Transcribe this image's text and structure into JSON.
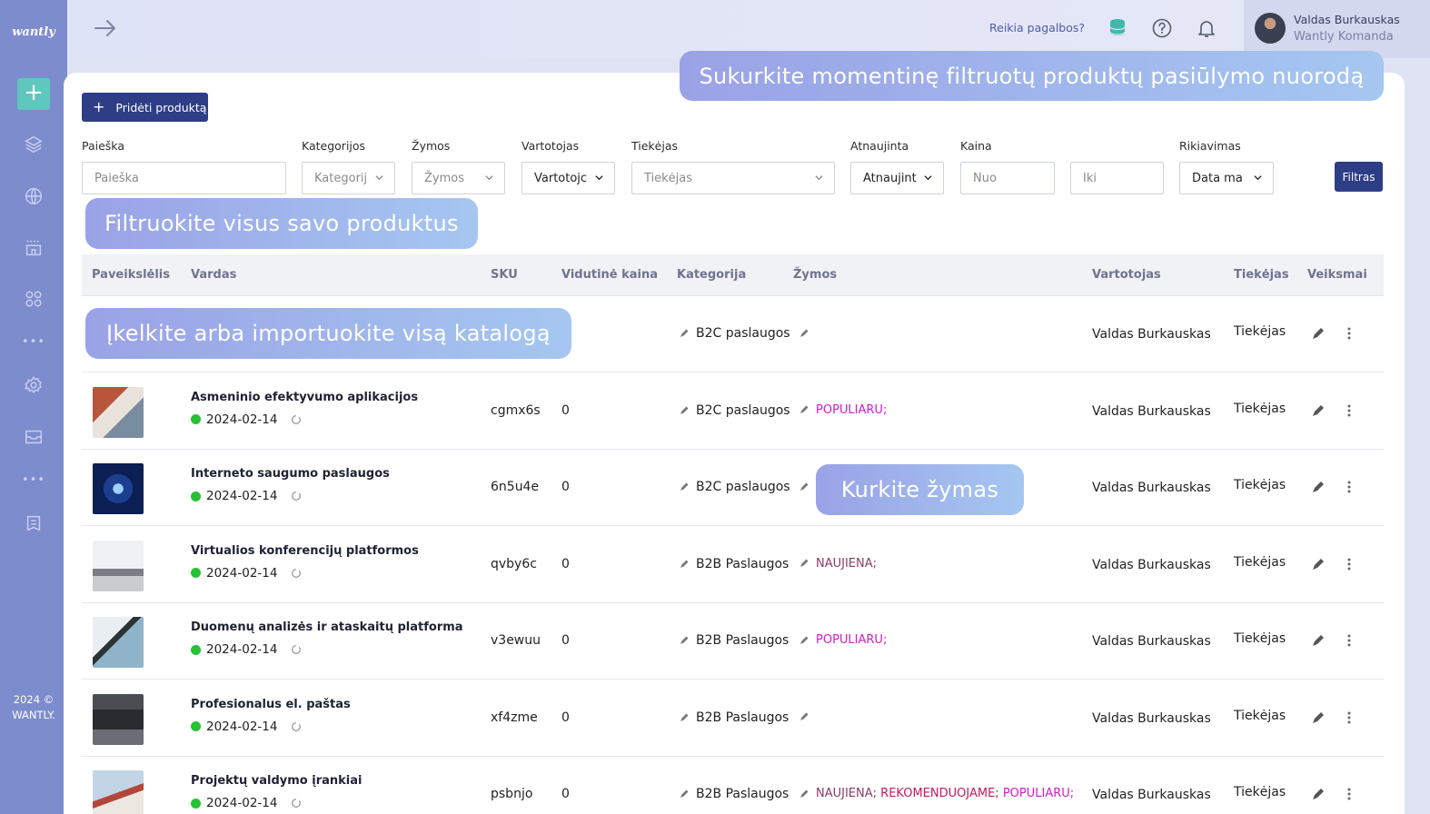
{
  "sidebar": {
    "logo": "wantly",
    "add_label": "+",
    "dots": "•••",
    "footer_year": "2024 ©",
    "footer_brand": "WANTLY."
  },
  "header": {
    "help_text": "Reikia pagalbos?",
    "user_name": "Valdas Burkauskas",
    "user_team": "Wantly Komanda"
  },
  "toolbar": {
    "add_product_label": "Pridėti produktą",
    "filter_button_label": "Filtras"
  },
  "filters": {
    "search": {
      "label": "Paieška",
      "placeholder": "Paieška"
    },
    "categories": {
      "label": "Kategorijos",
      "value": "Kategorij"
    },
    "tags": {
      "label": "Žymos",
      "value": "Žymos"
    },
    "user": {
      "label": "Vartotojas",
      "value": "Vartotojc"
    },
    "supplier": {
      "label": "Tiekėjas",
      "value": "Tiekėjas"
    },
    "updated": {
      "label": "Atnaujinta",
      "value": "Atnaujint"
    },
    "price": {
      "label": "Kaina",
      "from_placeholder": "Nuo",
      "to_placeholder": "Iki"
    },
    "sort": {
      "label": "Rikiavimas",
      "value": "Data ma"
    }
  },
  "table": {
    "columns": [
      "Paveikslėlis",
      "Vardas",
      "SKU",
      "Vidutinė kaina",
      "Kategorija",
      "Žymos",
      "Vartotojas",
      "Tiekėjas",
      "Veiksmai"
    ],
    "rows": [
      {
        "name": "",
        "date": "",
        "sku": "",
        "price": "",
        "category": "B2C paslaugos",
        "tags": [],
        "user": "Valdas Burkauskas",
        "supplier": "Tiekėjas"
      },
      {
        "name": "Asmeninio efektyvumo aplikacijos",
        "date": "2024-02-14",
        "sku": "cgmx6s",
        "price": "0",
        "category": "B2C paslaugos",
        "tags": [
          {
            "text": "POPULIARU;",
            "kind": "pop"
          }
        ],
        "user": "Valdas Burkauskas",
        "supplier": "Tiekėjas"
      },
      {
        "name": "Interneto saugumo paslaugos",
        "date": "2024-02-14",
        "sku": "6n5u4e",
        "price": "0",
        "category": "B2C paslaugos",
        "tags": [],
        "user": "Valdas Burkauskas",
        "supplier": "Tiekėjas"
      },
      {
        "name": "Virtualios konferencijų platformos",
        "date": "2024-02-14",
        "sku": "qvby6c",
        "price": "0",
        "category": "B2B Paslaugos",
        "tags": [
          {
            "text": "NAUJIENA;",
            "kind": "new"
          }
        ],
        "user": "Valdas Burkauskas",
        "supplier": "Tiekėjas"
      },
      {
        "name": "Duomenų analizės ir ataskaitų platforma",
        "date": "2024-02-14",
        "sku": "v3ewuu",
        "price": "0",
        "category": "B2B Paslaugos",
        "tags": [
          {
            "text": "POPULIARU;",
            "kind": "pop"
          }
        ],
        "user": "Valdas Burkauskas",
        "supplier": "Tiekėjas"
      },
      {
        "name": "Profesionalus el. paštas",
        "date": "2024-02-14",
        "sku": "xf4zme",
        "price": "0",
        "category": "B2B Paslaugos",
        "tags": [],
        "user": "Valdas Burkauskas",
        "supplier": "Tiekėjas"
      },
      {
        "name": "Projektų valdymo įrankiai",
        "date": "2024-02-14",
        "sku": "psbnjo",
        "price": "0",
        "category": "B2B Paslaugos",
        "tags": [
          {
            "text": "NAUJIENA;",
            "kind": "new"
          },
          {
            "text": "REKOMENDUOJAME;",
            "kind": "rec"
          },
          {
            "text": "POPULIARU;",
            "kind": "pop"
          }
        ],
        "user": "Valdas Burkauskas",
        "supplier": "Tiekėjas"
      }
    ]
  },
  "callouts": {
    "share_link": "Sukurkite momentinę filtruotų produktų pasiūlymo nuorodą",
    "filter_all": "Filtruokite visus savo produktus",
    "import_catalog": "Įkelkite arba importuokite visą katalogą",
    "create_tags": "Kurkite žymas"
  },
  "colors": {
    "sidebar": "#7d8ccd",
    "primary": "#2d3d86",
    "accent_teal": "#5fc7bd",
    "status_active": "#26c234",
    "tag_popular": "#d41cce",
    "tag_new": "#8a3b6a",
    "tag_recommended": "#c41a5d"
  },
  "icons": [
    "plus-icon",
    "layers-icon",
    "globe-icon",
    "store-icon",
    "grid-icon",
    "gear-icon",
    "inbox-icon",
    "receipt-icon",
    "arrow-right-icon",
    "database-icon",
    "question-icon",
    "bell-icon",
    "pencil-icon",
    "more-vertical-icon",
    "sync-icon",
    "chevron-down-icon"
  ]
}
